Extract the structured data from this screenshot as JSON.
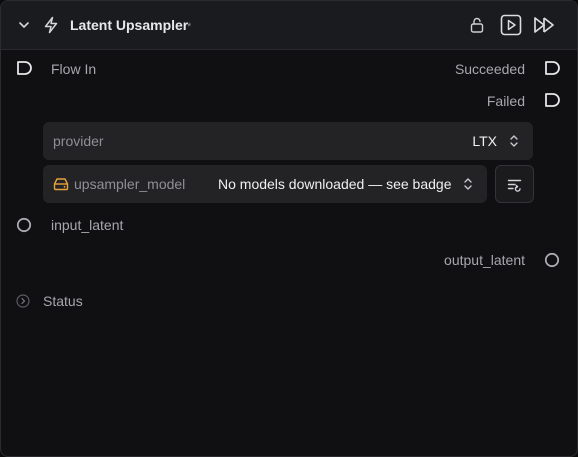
{
  "node": {
    "title": "Latent Upsampler",
    "modified_marker": "*"
  },
  "ports": {
    "flow_in": "Flow In",
    "succeeded": "Succeeded",
    "failed": "Failed",
    "input_latent": "input_latent",
    "output_latent": "output_latent"
  },
  "params": {
    "provider": {
      "label": "provider",
      "value": "LTX"
    },
    "upsampler_model": {
      "label": "upsampler_model",
      "value": "No models downloaded — see badge"
    }
  },
  "status": {
    "label": "Status"
  },
  "icons": {
    "collapse": "chevron-down-icon",
    "node_type": "lightning-bolt-icon",
    "lock": "unlock-icon",
    "run": "play-icon",
    "run_all": "fast-forward-icon",
    "model": "hard-drive-icon",
    "model_settings": "list-settings-icon",
    "status_toggle": "chevron-right-circle-icon"
  },
  "colors": {
    "background": "#101012",
    "header": "#1a1b1e",
    "field": "#232326",
    "warning_icon": "#e8a33d",
    "text_primary": "#f0f0f2",
    "text_muted": "#a7a7ad"
  }
}
